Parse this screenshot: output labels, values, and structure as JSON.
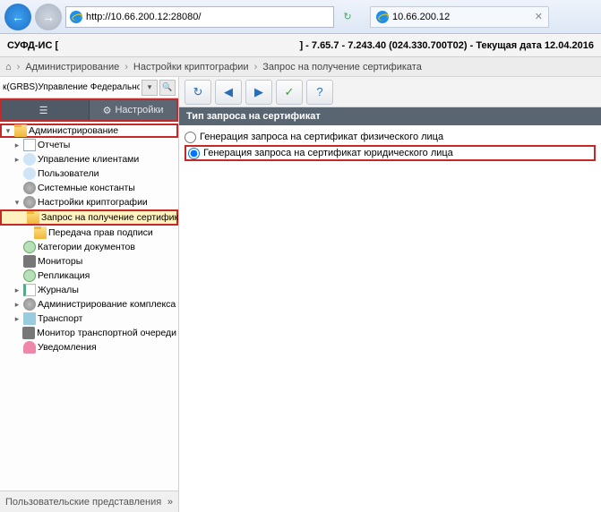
{
  "browser": {
    "url": "http://10.66.200.12:28080/",
    "tab_title": "10.66.200.12"
  },
  "app": {
    "name": "СУФД-ИС [",
    "title_right": "] - 7.65.7 - 7.243.40 (024.330.700Т02) - Текущая дата 12.04.2016"
  },
  "crumb": {
    "c1": "Администрирование",
    "c2": "Настройки криптографии",
    "c3": "Запрос на получение сертификата"
  },
  "org_selector": "к(GRBS)Управление Федерального казначейства",
  "sidebar_tabs": {
    "menu": "",
    "settings": "Настройки"
  },
  "tree": {
    "admin": "Администрирование",
    "reports": "Отчеты",
    "clients": "Управление клиентами",
    "users": "Пользователи",
    "consts": "Системные константы",
    "crypto": "Настройки криптографии",
    "certreq": "Запрос на получение сертификата",
    "signrights": "Передача прав подписи",
    "doccats": "Категории документов",
    "monitors": "Мониторы",
    "repl": "Репликация",
    "journals": "Журналы",
    "complex": "Администрирование комплекса",
    "transport": "Транспорт",
    "tqueue": "Монитор транспортной очереди",
    "notif": "Уведомления"
  },
  "bottom_panel": "Пользовательские представления",
  "content": {
    "section": "Тип запроса на сертификат",
    "opt1": "Генерация запроса на сертификат физического лица",
    "opt2": "Генерация запроса на сертификат юридического лица"
  }
}
